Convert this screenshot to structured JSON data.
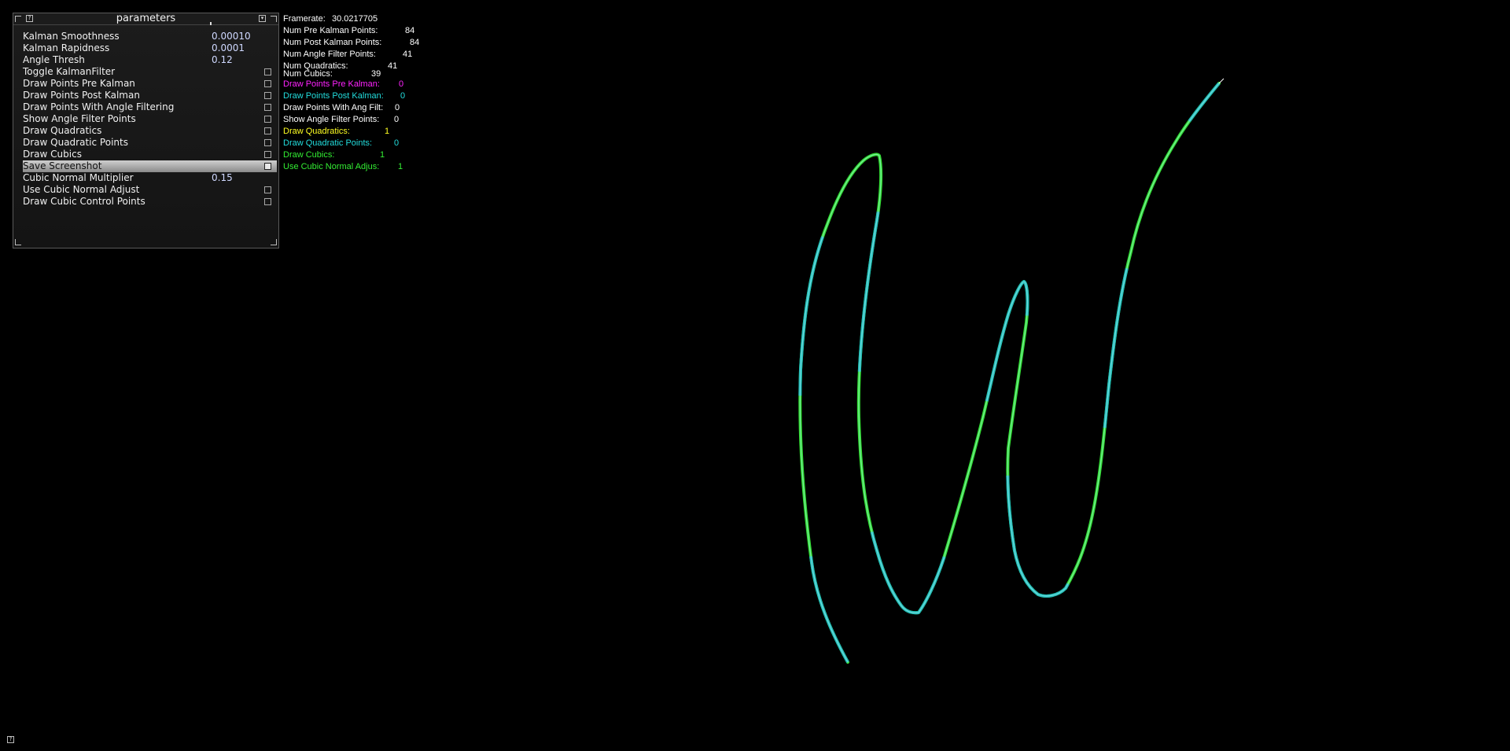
{
  "panel": {
    "title": "parameters",
    "help_glyph": "?",
    "collapse_glyph": "▾",
    "rows": [
      {
        "label": "Kalman Smoothness",
        "value": "0.00010"
      },
      {
        "label": "Kalman Rapidness",
        "value": "0.0001"
      },
      {
        "label": "Angle Thresh",
        "value": "0.12"
      },
      {
        "label": "Toggle KalmanFilter",
        "checked": false
      },
      {
        "label": "Draw Points Pre Kalman",
        "checked": false
      },
      {
        "label": "Draw Points Post Kalman",
        "checked": false
      },
      {
        "label": "Draw Points With Angle Filtering",
        "checked": false
      },
      {
        "label": "Show Angle Filter Points",
        "checked": false
      },
      {
        "label": "Draw Quadratics",
        "checked": false
      },
      {
        "label": "Draw Quadratic Points",
        "checked": false
      },
      {
        "label": "Draw Cubics",
        "checked": false
      },
      {
        "label": "Save Screenshot",
        "checked": false,
        "highlighted": true
      },
      {
        "label": "Cubic Normal Multiplier",
        "value": "0.15"
      },
      {
        "label": "Use Cubic Normal Adjust",
        "checked": false
      },
      {
        "label": "Draw Cubic Control Points",
        "checked": false
      }
    ]
  },
  "stats": {
    "framerate": {
      "label": "Framerate:",
      "value": "30.0217705",
      "color": "#ffffff"
    },
    "pre_kalman": {
      "label": "Num Pre Kalman Points:",
      "value": "84",
      "color": "#ffffff"
    },
    "post_kalman": {
      "label": "Num Post Kalman Points:",
      "value": "84",
      "color": "#ffffff"
    },
    "angle_filter": {
      "label": "Num Angle Filter Points:",
      "value": "41",
      "color": "#ffffff"
    },
    "quadratics": {
      "label": "Num Quadratics:",
      "value": "41",
      "color": "#ffffff"
    },
    "cubics": {
      "label": "Num Cubics:",
      "value": "39",
      "color": "#ffffff"
    },
    "draw_pre": {
      "label": "Draw Points Pre Kalman:",
      "value": "0",
      "color": "#ff22ff"
    },
    "draw_post": {
      "label": "Draw Points Post Kalman:",
      "value": "0",
      "color": "#22dddd"
    },
    "draw_ang": {
      "label": "Draw Points With Ang Filt:",
      "value": "0",
      "color": "#ffffff"
    },
    "show_ang": {
      "label": "Show Angle Filter Points:",
      "value": "0",
      "color": "#ffffff"
    },
    "draw_quad": {
      "label": "Draw Quadratics:",
      "value": "1",
      "color": "#ffff22"
    },
    "draw_quad_pts": {
      "label": "Draw Quadratic Points:",
      "value": "0",
      "color": "#22dddd"
    },
    "draw_cubics": {
      "label": "Draw Cubics:",
      "value": "1",
      "color": "#33ee33"
    },
    "cubic_adjust": {
      "label": "Use Cubic Normal Adjus:",
      "value": "1",
      "color": "#33ee33"
    }
  },
  "stroke": {
    "colors": [
      "#33dd33",
      "#22bbbb"
    ]
  },
  "corner_help_glyph": "?"
}
